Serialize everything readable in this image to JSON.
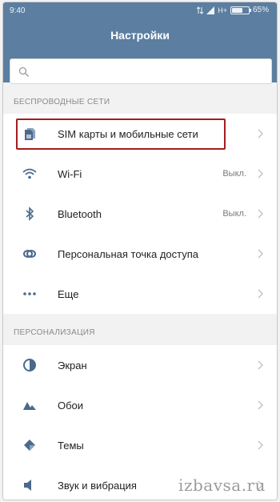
{
  "status": {
    "time": "9:40",
    "network": "H+",
    "battery": "65%",
    "battery_level": 0.65
  },
  "header": {
    "title": "Настройки"
  },
  "search": {
    "placeholder": "",
    "icon": "search-icon"
  },
  "sections": [
    {
      "title": "БЕСПРОВОДНЫЕ СЕТИ",
      "items": [
        {
          "label": "SIM карты и мобильные сети",
          "value": "",
          "icon": "sim-cards-icon",
          "highlighted": true
        },
        {
          "label": "Wi-Fi",
          "value": "Выкл.",
          "icon": "wifi-icon"
        },
        {
          "label": "Bluetooth",
          "value": "Выкл.",
          "icon": "bluetooth-icon"
        },
        {
          "label": "Персональная точка доступа",
          "value": "",
          "icon": "hotspot-icon"
        },
        {
          "label": "Еще",
          "value": "",
          "icon": "more-icon"
        }
      ]
    },
    {
      "title": "ПЕРСОНАЛИЗАЦИЯ",
      "items": [
        {
          "label": "Экран",
          "value": "",
          "icon": "display-icon"
        },
        {
          "label": "Обои",
          "value": "",
          "icon": "wallpaper-icon"
        },
        {
          "label": "Темы",
          "value": "",
          "icon": "themes-icon"
        },
        {
          "label": "Звук и вибрация",
          "value": "",
          "icon": "sound-icon"
        }
      ]
    }
  ],
  "watermark": "izbavsa.ru",
  "colors": {
    "header_bg": "#5b7ea1",
    "highlight": "#a21d1d",
    "icon": "#4a6a8c"
  }
}
